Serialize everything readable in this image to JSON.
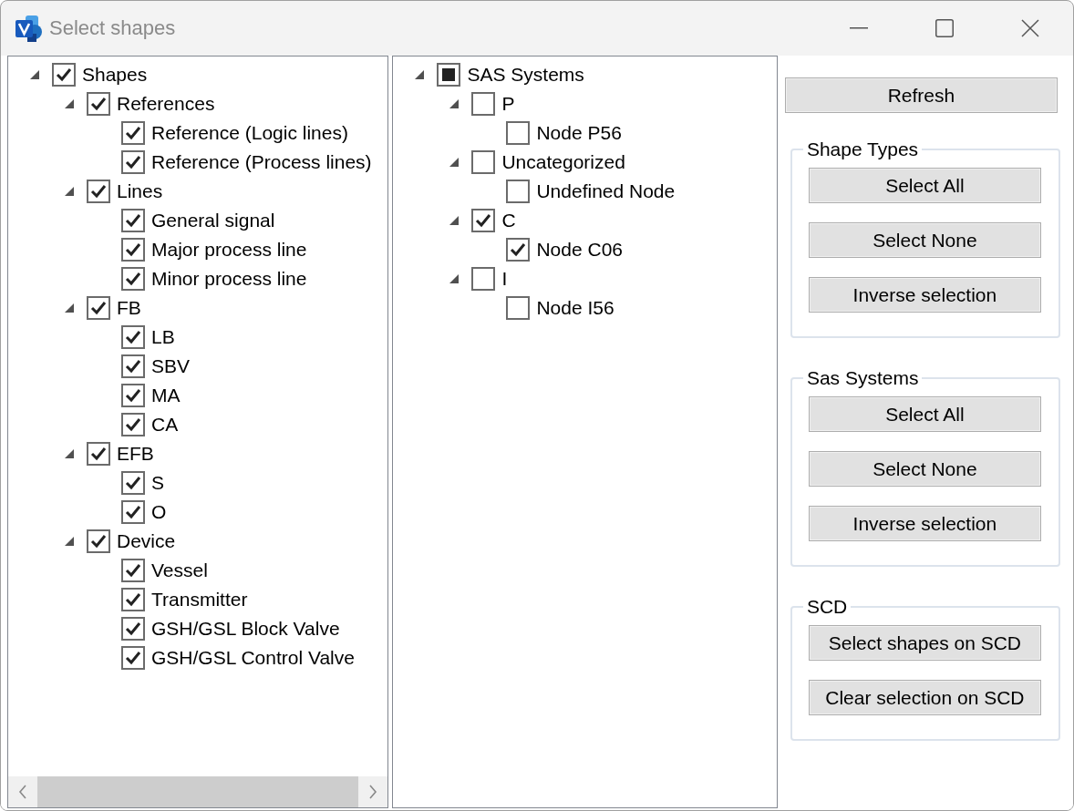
{
  "window": {
    "title": "Select shapes"
  },
  "shape_tree": [
    {
      "label": "Shapes",
      "checked": true,
      "expanded": true,
      "children": [
        {
          "label": "References",
          "checked": true,
          "expanded": true,
          "children": [
            {
              "label": "Reference (Logic lines)",
              "checked": true
            },
            {
              "label": "Reference (Process lines)",
              "checked": true
            }
          ]
        },
        {
          "label": "Lines",
          "checked": true,
          "expanded": true,
          "children": [
            {
              "label": "General signal",
              "checked": true
            },
            {
              "label": "Major process line",
              "checked": true
            },
            {
              "label": "Minor process line",
              "checked": true
            }
          ]
        },
        {
          "label": "FB",
          "checked": true,
          "expanded": true,
          "children": [
            {
              "label": "LB",
              "checked": true
            },
            {
              "label": "SBV",
              "checked": true
            },
            {
              "label": "MA",
              "checked": true
            },
            {
              "label": "CA",
              "checked": true
            }
          ]
        },
        {
          "label": "EFB",
          "checked": true,
          "expanded": true,
          "children": [
            {
              "label": "S",
              "checked": true
            },
            {
              "label": "O",
              "checked": true
            }
          ]
        },
        {
          "label": "Device",
          "checked": true,
          "expanded": true,
          "children": [
            {
              "label": "Vessel",
              "checked": true
            },
            {
              "label": "Transmitter",
              "checked": true
            },
            {
              "label": "GSH/GSL Block Valve",
              "checked": true
            },
            {
              "label": "GSH/GSL Control  Valve",
              "checked": true
            }
          ]
        }
      ]
    }
  ],
  "sas_tree": [
    {
      "label": "SAS Systems",
      "indeterminate": true,
      "expanded": true,
      "children": [
        {
          "label": "P",
          "checked": false,
          "expanded": true,
          "children": [
            {
              "label": "Node P56",
              "checked": false
            }
          ]
        },
        {
          "label": "Uncategorized",
          "checked": false,
          "expanded": true,
          "children": [
            {
              "label": "Undefined Node",
              "checked": false
            }
          ]
        },
        {
          "label": "C",
          "checked": true,
          "expanded": true,
          "children": [
            {
              "label": "Node C06",
              "checked": true
            }
          ]
        },
        {
          "label": "I",
          "checked": false,
          "expanded": true,
          "children": [
            {
              "label": "Node I56",
              "checked": false
            }
          ]
        }
      ]
    }
  ],
  "refresh_button": "Refresh",
  "groups": [
    {
      "title": "Shape Types",
      "buttons": [
        "Select All",
        "Select None",
        "Inverse selection"
      ]
    },
    {
      "title": "Sas Systems",
      "buttons": [
        "Select All",
        "Select None",
        "Inverse selection"
      ]
    },
    {
      "title": "SCD",
      "buttons": [
        "Select shapes on SCD",
        "Clear selection on SCD"
      ]
    }
  ]
}
